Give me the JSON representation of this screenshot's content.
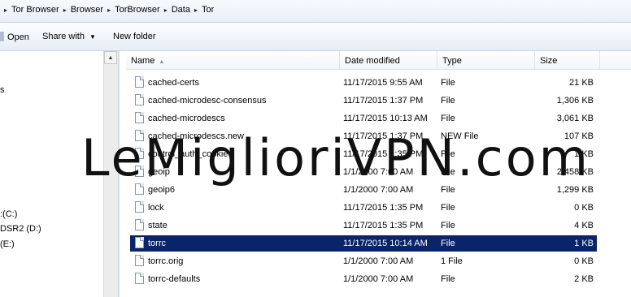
{
  "breadcrumb": {
    "items": [
      "Tor Browser",
      "Browser",
      "TorBrowser",
      "Data",
      "Tor"
    ],
    "prefix_separator": "▸",
    "separator": "▸"
  },
  "toolbar": {
    "open_label": "Open",
    "share_label": "Share with",
    "share_dropdown": "▼",
    "new_folder_label": "New folder"
  },
  "nav": {
    "items": [
      "s",
      ":(C:)",
      "DSR2 (D:)",
      "(E:)"
    ]
  },
  "columns": {
    "name": "Name",
    "date": "Date modified",
    "type": "Type",
    "size": "Size"
  },
  "files": [
    {
      "name": "cached-certs",
      "date": "11/17/2015 9:55 AM",
      "type": "File",
      "size": "21 KB"
    },
    {
      "name": "cached-microdesc-consensus",
      "date": "11/17/2015 1:37 PM",
      "type": "File",
      "size": "1,306 KB"
    },
    {
      "name": "cached-microdescs",
      "date": "11/17/2015 10:13 AM",
      "type": "File",
      "size": "3,061 KB"
    },
    {
      "name": "cached-microdescs.new",
      "date": "11/17/2015 1:37 PM",
      "type": "NEW File",
      "size": "107 KB"
    },
    {
      "name": "control_auth_cookie",
      "date": "11/17/2015 1:35 PM",
      "type": "File",
      "size": "1 KB"
    },
    {
      "name": "geoip",
      "date": "1/1/2000 7:00 AM",
      "type": "File",
      "size": "2,458 KB"
    },
    {
      "name": "geoip6",
      "date": "1/1/2000 7:00 AM",
      "type": "File",
      "size": "1,299 KB"
    },
    {
      "name": "lock",
      "date": "11/17/2015 1:35 PM",
      "type": "File",
      "size": "0 KB"
    },
    {
      "name": "state",
      "date": "11/17/2015 1:35 PM",
      "type": "File",
      "size": "4 KB"
    },
    {
      "name": "torrc",
      "date": "11/17/2015 10:14 AM",
      "type": "File",
      "size": "1 KB"
    },
    {
      "name": "torrc.orig",
      "date": "1/1/2000 7:00 AM",
      "type": "1 File",
      "size": "0 KB"
    },
    {
      "name": "torrc-defaults",
      "date": "1/1/2000 7:00 AM",
      "type": "File",
      "size": "2 KB"
    }
  ],
  "selected_file": "torrc",
  "watermark": "LeMiglioriVPN.com",
  "colors": {
    "selection": "#0a246a",
    "selection_text": "#ffffff"
  }
}
